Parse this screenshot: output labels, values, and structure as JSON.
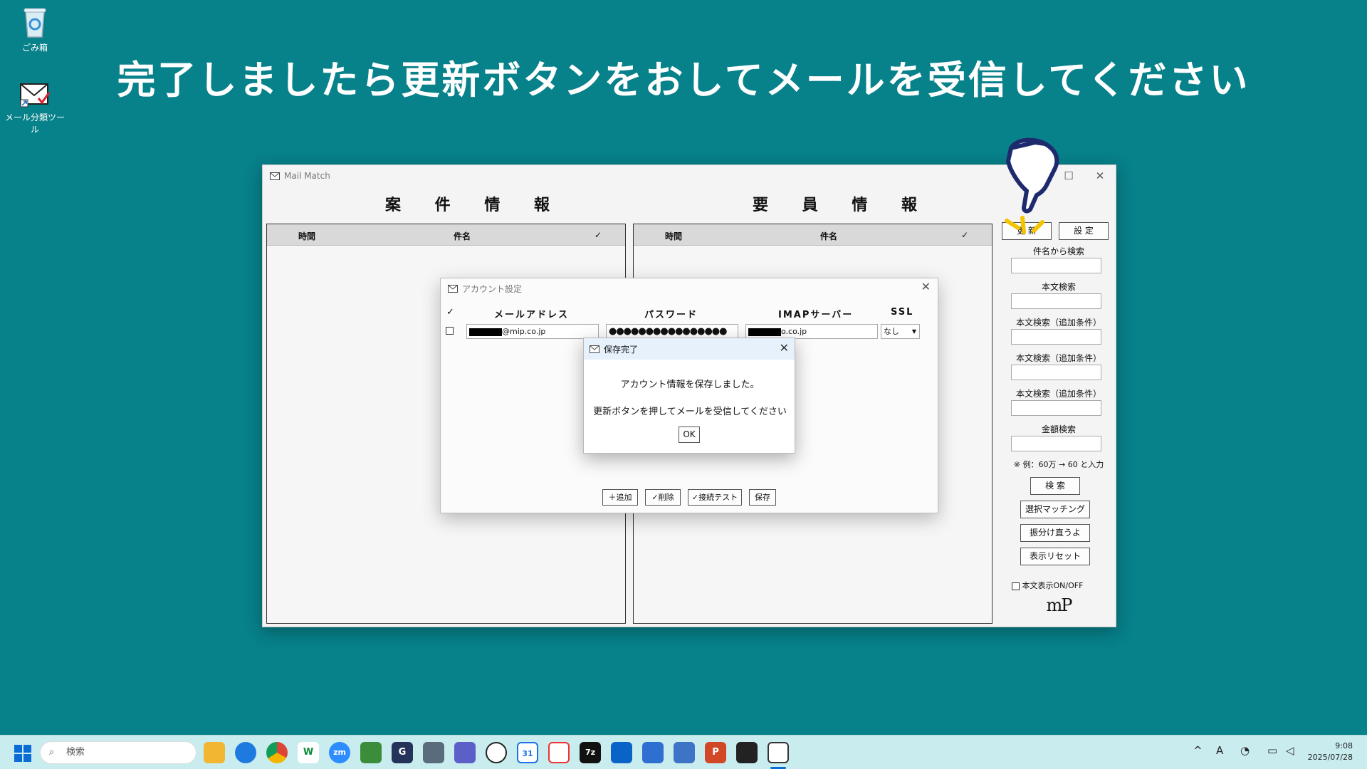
{
  "desktop": {
    "icons": [
      {
        "label": "ごみ箱"
      },
      {
        "label": "メール分類ツール"
      }
    ],
    "banner": "完了しましたら更新ボタンをおしてメールを受信してください"
  },
  "window": {
    "title": "Mail Match",
    "left_title": "案 件 情 報",
    "right_title": "要 員 情 報",
    "col_time": "時間",
    "col_subject": "件名",
    "col_check": "✓",
    "right_col_time": "時間",
    "right_col_subject": "件名",
    "right_col_check": "✓"
  },
  "sidebar": {
    "refresh_button": "更 新",
    "settings_button": "設 定",
    "subject_search_label": "件名から検索",
    "body_search_label": "本文検索",
    "body_search_add1_label": "本文検索（追加条件）",
    "body_search_add2_label": "本文検索（追加条件）",
    "body_search_add3_label": "本文検索（追加条件）",
    "amount_search_label": "金額検索",
    "amount_hint": "※ 例：60万 → 60 と入力",
    "search_button": "検 索",
    "select_matching_button": "選択マッチング",
    "assign_button": "振分け直うよ",
    "display_reset_button": "表示リセット",
    "body_toggle_label": "本文表示ON/OFF",
    "logo": "mP"
  },
  "account_dialog": {
    "title": "アカウント設定",
    "col_check": "✓",
    "col_email": "メールアドレス",
    "col_password": "パスワード",
    "col_imap": "IMAPサーバー",
    "col_ssl": "SSL",
    "row": {
      "email_suffix": "@mip.co.jp",
      "password_mask": "●●●●●●●●●●●●●●●●",
      "imap_suffix": "o.co.jp",
      "ssl_value": "なし"
    },
    "add_button": "＋追加",
    "delete_button": "✓削除",
    "test_button": "✓接続テスト",
    "save_button": "保存"
  },
  "message_box": {
    "title": "保存完了",
    "line1": "アカウント情報を保存しました。",
    "line2": "更新ボタンを押してメールを受信してください",
    "ok_button": "OK"
  },
  "taskbar": {
    "search_placeholder": "検索",
    "app_labels": [
      "W",
      "zm",
      "G",
      "31",
      "7z",
      "P"
    ],
    "tray_ime": "A",
    "time": "9:08",
    "date": "2025/07/28"
  },
  "colors": {
    "desktop_bg": "#07818a",
    "banner_text": "#ffffff",
    "hand_outline": "#1e2a6e",
    "sparkle": "#f5c400"
  }
}
